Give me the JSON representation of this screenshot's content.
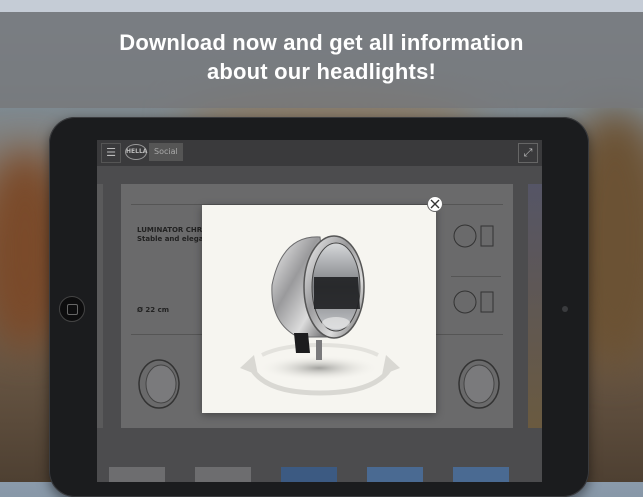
{
  "banner": {
    "line1": "Download now and get all information",
    "line2": "about our headlights!"
  },
  "app": {
    "menu_icon": "hamburger-icon",
    "logo_text": "HELLA",
    "social_label": "Social",
    "expand_icon": "expand-icon"
  },
  "document": {
    "title": "LUMINATOR CHROM",
    "subtitle": "Stable and elegant",
    "size": "Ø 22 cm"
  },
  "modal": {
    "close_icon": "close-icon",
    "rotate_icon": "rotate-360-icon"
  },
  "colors": {
    "banner": "#76787a",
    "modal_bg": "#f6f5f0",
    "ipad_frame": "#1b1c1e"
  }
}
